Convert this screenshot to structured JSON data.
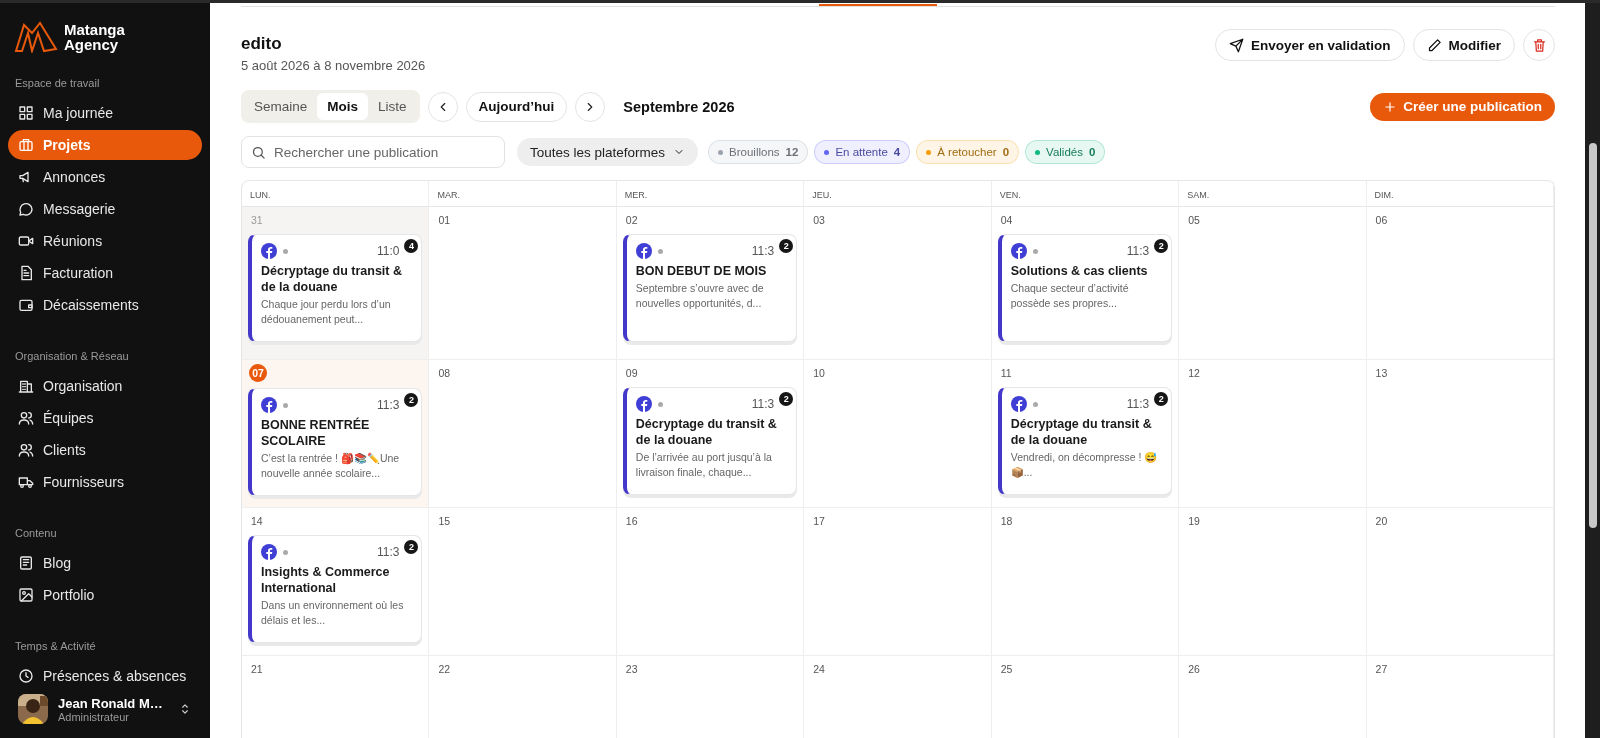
{
  "sidebar": {
    "brand_line_1": "Matanga",
    "brand_line_2": "Agency",
    "sections": [
      {
        "title": "Espace de travail",
        "items": [
          {
            "label": "Ma journée",
            "selected": false
          },
          {
            "label": "Projets",
            "selected": true
          },
          {
            "label": "Annonces",
            "selected": false
          },
          {
            "label": "Messagerie",
            "selected": false
          },
          {
            "label": "Réunions",
            "selected": false
          },
          {
            "label": "Facturation",
            "selected": false
          },
          {
            "label": "Décaissements",
            "selected": false
          }
        ]
      },
      {
        "title": "Organisation & Réseau",
        "items": [
          {
            "label": "Organisation",
            "selected": false
          },
          {
            "label": "Équipes",
            "selected": false
          },
          {
            "label": "Clients",
            "selected": false
          },
          {
            "label": "Fournisseurs",
            "selected": false
          }
        ]
      },
      {
        "title": "Contenu",
        "items": [
          {
            "label": "Blog",
            "selected": false
          },
          {
            "label": "Portfolio",
            "selected": false
          }
        ]
      },
      {
        "title": "Temps & Activité",
        "items": [
          {
            "label": "Présences & absences",
            "selected": false
          }
        ]
      }
    ],
    "user": {
      "name": "Jean Ronald M…",
      "role": "Administrateur"
    }
  },
  "header": {
    "title": "edito",
    "dates": "5 août 2026 à 8 novembre 2026",
    "actions": [
      {
        "label": "Envoyer en validation"
      },
      {
        "label": "Modifier"
      }
    ]
  },
  "view_tabs": [
    {
      "label": "Semaine",
      "selected": false
    },
    {
      "label": "Mois",
      "selected": true
    },
    {
      "label": "Liste",
      "selected": false
    }
  ],
  "today_button": "Aujourd’hui",
  "month": "Septembre 2026",
  "create_button": "Créer une publication",
  "search": {
    "placeholder": "Rechercher une publication"
  },
  "platform_filter": "Toutes les plateformes",
  "status_filters": [
    {
      "label": "Brouillons",
      "count": "12",
      "color": "#9ca3af"
    },
    {
      "label": "En attente",
      "count": "4",
      "color": "#6366f1"
    },
    {
      "label": "À retoucher",
      "count": "0",
      "color": "#f59e0b"
    },
    {
      "label": "Validés",
      "count": "0",
      "color": "#10b981"
    }
  ],
  "calendar": {
    "weekdays": [
      "LUN.",
      "MAR.",
      "MER.",
      "JEU.",
      "VEN.",
      "SAM.",
      "DIM."
    ],
    "weeks": [
      {
        "days": [
          {
            "day": "31",
            "outside_month": true,
            "today": false,
            "posts": [
              {
                "time": "11:0",
                "count": "4",
                "title": "Décryptage du transit & de la douane",
                "excerpt": "Chaque jour perdu lors d’un dédouanement peut..."
              }
            ]
          },
          {
            "day": "01",
            "outside_month": false,
            "today": false
          },
          {
            "day": "02",
            "outside_month": false,
            "today": false,
            "posts": [
              {
                "time": "11:3",
                "count": "2",
                "title": "BON DEBUT DE MOIS",
                "excerpt": "Septembre s’ouvre avec de nouvelles opportunités, d..."
              }
            ]
          },
          {
            "day": "03",
            "outside_month": false,
            "today": false
          },
          {
            "day": "04",
            "outside_month": false,
            "today": false,
            "posts": [
              {
                "time": "11:3",
                "count": "2",
                "title": "Solutions & cas clients",
                "excerpt": "Chaque secteur d’activité possède ses propres..."
              }
            ]
          },
          {
            "day": "05",
            "outside_month": false,
            "today": false
          },
          {
            "day": "06",
            "outside_month": false,
            "today": false
          }
        ]
      },
      {
        "days": [
          {
            "day": "07",
            "outside_month": false,
            "today": true,
            "posts": [
              {
                "time": "11:3",
                "count": "2",
                "title": "BONNE RENTRÉE SCOLAIRE",
                "excerpt": "C’est la rentrée ! 🎒📚✏️Une nouvelle année scolaire..."
              }
            ]
          },
          {
            "day": "08",
            "outside_month": false,
            "today": false
          },
          {
            "day": "09",
            "outside_month": false,
            "today": false,
            "posts": [
              {
                "time": "11:3",
                "count": "2",
                "title": "Décryptage du transit & de la douane",
                "excerpt": "De l’arrivée au port jusqu’à la livraison finale, chaque..."
              }
            ]
          },
          {
            "day": "10",
            "outside_month": false,
            "today": false
          },
          {
            "day": "11",
            "outside_month": false,
            "today": false,
            "posts": [
              {
                "time": "11:3",
                "count": "2",
                "title": "Décryptage du transit & de la douane",
                "excerpt": "Vendredi, on décompresse ! 😅📦..."
              }
            ]
          },
          {
            "day": "12",
            "outside_month": false,
            "today": false
          },
          {
            "day": "13",
            "outside_month": false,
            "today": false
          }
        ]
      },
      {
        "days": [
          {
            "day": "14",
            "outside_month": false,
            "today": false,
            "posts": [
              {
                "time": "11:3",
                "count": "2",
                "title": "Insights & Commerce International",
                "excerpt": "Dans un environnement où les délais et les..."
              }
            ]
          },
          {
            "day": "15",
            "outside_month": false,
            "today": false
          },
          {
            "day": "16",
            "outside_month": false,
            "today": false
          },
          {
            "day": "17",
            "outside_month": false,
            "today": false
          },
          {
            "day": "18",
            "outside_month": false,
            "today": false
          },
          {
            "day": "19",
            "outside_month": false,
            "today": false
          },
          {
            "day": "20",
            "outside_month": false,
            "today": false
          }
        ]
      },
      {
        "days": [
          {
            "day": "21",
            "outside_month": false,
            "today": false
          },
          {
            "day": "22",
            "outside_month": false,
            "today": false
          },
          {
            "day": "23",
            "outside_month": false,
            "today": false
          },
          {
            "day": "24",
            "outside_month": false,
            "today": false
          },
          {
            "day": "25",
            "outside_month": false,
            "today": false
          },
          {
            "day": "26",
            "outside_month": false,
            "today": false
          },
          {
            "day": "27",
            "outside_month": false,
            "today": false
          }
        ]
      }
    ]
  }
}
